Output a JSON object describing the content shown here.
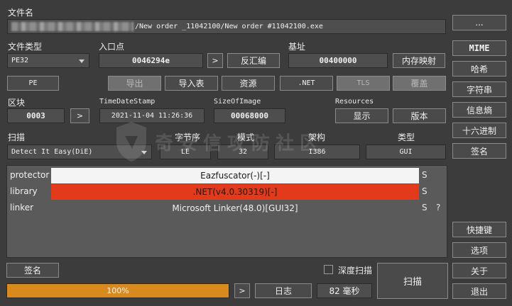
{
  "file": {
    "label": "文件名",
    "path": "/New order _11042100/New order #11042100.exe",
    "browse_label": "..."
  },
  "filetype": {
    "label": "文件类型",
    "value": "PE32"
  },
  "entry": {
    "label": "入口点",
    "value": "0046294e",
    "go_label": ">",
    "disasm_label": "反汇编"
  },
  "base": {
    "label": "基址",
    "value": "00400000",
    "memmap_label": "内存映射"
  },
  "toolbar": {
    "pe_label": "PE",
    "export_label": "导出",
    "import_label": "导入表",
    "resource_label": "资源",
    "net_label": ".NET",
    "tls_label": "TLS",
    "overlay_label": "覆盖"
  },
  "section": {
    "label": "区块",
    "value": "0003",
    "go_label": ">"
  },
  "timestamp": {
    "label": "TimeDateStamp",
    "value": "2021-11-04 11:26:36"
  },
  "sizeofimage": {
    "label": "SizeOfImage",
    "value": "00068000"
  },
  "resources": {
    "label": "Resources",
    "show_label": "显示",
    "version_label": "版本"
  },
  "scan": {
    "label": "扫描",
    "engine": "Detect It Easy(DiE)",
    "endian_label": "字节序",
    "endian": "LE",
    "mode_label": "模式",
    "mode": "32",
    "arch_label": "架构",
    "arch": "I386",
    "type_label": "类型",
    "type": "GUI"
  },
  "results": [
    {
      "type": "protector",
      "name": "Eazfuscator(-)[-]",
      "s": "S",
      "q": "",
      "bg": "#f4f4f4",
      "fg": "#1a1a1a"
    },
    {
      "type": "library",
      "name": ".NET(v4.0.30319)[-]",
      "s": "S",
      "q": "",
      "bg": "#e23a1a",
      "fg": "#1a1a1a"
    },
    {
      "type": "linker",
      "name": "Microsoft Linker(48.0)[GUI32]",
      "s": "S",
      "q": "?",
      "bg": "",
      "fg": "#f0f0f0"
    }
  ],
  "watermark": "奇安信攻防社区",
  "sidebar": {
    "mime": "MIME",
    "hash": "哈希",
    "strings": "字符串",
    "entropy": "信息熵",
    "hex": "十六进制",
    "signature": "签名",
    "shortcuts": "快捷键",
    "options": "选项",
    "about": "关于",
    "exit": "退出"
  },
  "bottom": {
    "signature_label": "签名",
    "deep_scan_label": "深度扫描",
    "scan_label": "扫描",
    "progress_text": "100%",
    "progress": 1.0,
    "go_label": ">",
    "log_label": "日志",
    "time_label": "82 毫秒"
  },
  "colors": {
    "accent": "#d98a1c",
    "library_bg": "#e23a1a",
    "background": "#3c3c3c"
  }
}
